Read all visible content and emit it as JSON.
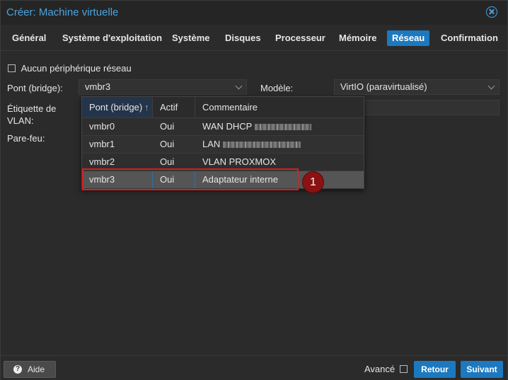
{
  "window": {
    "title": "Créer: Machine virtuelle"
  },
  "tabs": [
    {
      "label": "Général"
    },
    {
      "label": "Système d'exploitation"
    },
    {
      "label": "Système"
    },
    {
      "label": "Disques"
    },
    {
      "label": "Processeur"
    },
    {
      "label": "Mémoire"
    },
    {
      "label": "Réseau"
    },
    {
      "label": "Confirmation"
    }
  ],
  "form": {
    "no_network_label": "Aucun périphérique réseau",
    "bridge_label": "Pont (bridge):",
    "bridge_value": "vmbr3",
    "model_label": "Modèle:",
    "model_value": "VirtIO (paravirtualisé)",
    "vlan_label_line1": "Étiquette de",
    "vlan_label_line2": "VLAN:",
    "firewall_label": "Pare-feu:"
  },
  "dropdown": {
    "headers": [
      "Pont (bridge)",
      "Actif",
      "Commentaire"
    ],
    "sort_arrow": "↑",
    "rows": [
      {
        "bridge": "vmbr0",
        "active": "Oui",
        "comment": "WAN DHCP"
      },
      {
        "bridge": "vmbr1",
        "active": "Oui",
        "comment": "LAN"
      },
      {
        "bridge": "vmbr2",
        "active": "Oui",
        "comment": "VLAN PROXMOX"
      },
      {
        "bridge": "vmbr3",
        "active": "Oui",
        "comment": "Adaptateur interne"
      }
    ]
  },
  "annotation": {
    "callout_number": "1",
    "color": "#d62020"
  },
  "footer": {
    "help_label": "Aide",
    "advanced_label": "Avancé",
    "back_label": "Retour",
    "next_label": "Suivant"
  },
  "colors": {
    "accent": "#1c79c0",
    "title": "#4aa3df",
    "background": "#2b2b2b"
  }
}
